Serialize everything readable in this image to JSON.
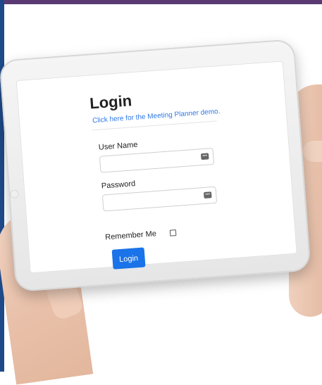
{
  "login": {
    "title": "Login",
    "demo_link": "Click here for the Meeting Planner demo.",
    "username_label": "User Name",
    "password_label": "Password",
    "remember_label": "Remember Me",
    "login_button": "Login"
  },
  "colors": {
    "primary": "#1a73e8",
    "link": "#2f7ae5",
    "top_bar": "#5b3a74",
    "left_bar": "#1f4a8a"
  }
}
